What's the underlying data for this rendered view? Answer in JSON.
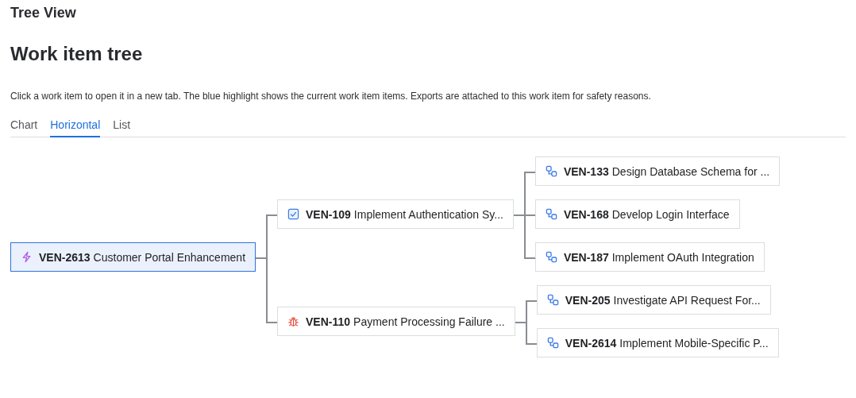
{
  "page_title": "Tree View",
  "heading": "Work item tree",
  "description": "Click a work item to open it in a new tab. The blue highlight shows the current work item items. Exports are attached to this work item for safety reasons.",
  "tabs": [
    {
      "label": "Chart",
      "selected": false
    },
    {
      "label": "Horizontal",
      "selected": true
    },
    {
      "label": "List",
      "selected": false
    }
  ],
  "tree": {
    "kind": "epic",
    "key": "VEN-2613",
    "title": "Customer Portal Enhancement",
    "selected": true,
    "children": [
      {
        "kind": "task",
        "key": "VEN-109",
        "title": "Implement Authentication Sy...",
        "selected": false,
        "children": [
          {
            "kind": "subtask",
            "key": "VEN-133",
            "title": "Design Database Schema for ...",
            "selected": false
          },
          {
            "kind": "subtask",
            "key": "VEN-168",
            "title": "Develop Login Interface",
            "selected": false
          },
          {
            "kind": "subtask",
            "key": "VEN-187",
            "title": "Implement OAuth Integration",
            "selected": false
          }
        ]
      },
      {
        "kind": "bug",
        "key": "VEN-110",
        "title": "Payment Processing Failure ...",
        "selected": false,
        "children": [
          {
            "kind": "subtask",
            "key": "VEN-205",
            "title": "Investigate API Request For...",
            "selected": false
          },
          {
            "kind": "subtask",
            "key": "VEN-2614",
            "title": "Implement Mobile-Specific P...",
            "selected": false
          }
        ]
      }
    ]
  }
}
